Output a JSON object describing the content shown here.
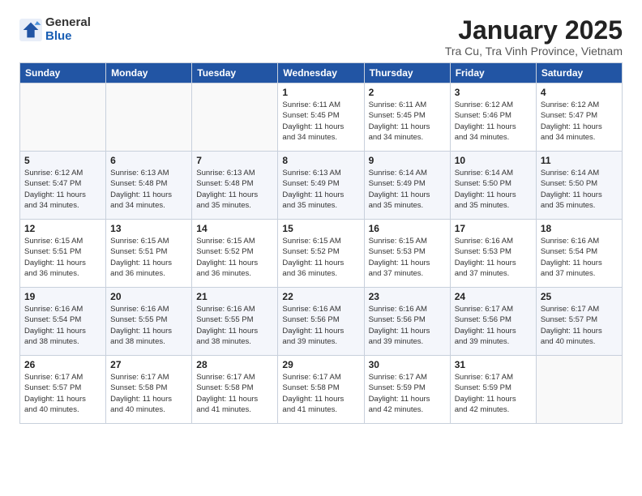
{
  "logo": {
    "general": "General",
    "blue": "Blue"
  },
  "title": "January 2025",
  "subtitle": "Tra Cu, Tra Vinh Province, Vietnam",
  "headers": [
    "Sunday",
    "Monday",
    "Tuesday",
    "Wednesday",
    "Thursday",
    "Friday",
    "Saturday"
  ],
  "weeks": [
    [
      {
        "day": "",
        "info": ""
      },
      {
        "day": "",
        "info": ""
      },
      {
        "day": "",
        "info": ""
      },
      {
        "day": "1",
        "info": "Sunrise: 6:11 AM\nSunset: 5:45 PM\nDaylight: 11 hours\nand 34 minutes."
      },
      {
        "day": "2",
        "info": "Sunrise: 6:11 AM\nSunset: 5:45 PM\nDaylight: 11 hours\nand 34 minutes."
      },
      {
        "day": "3",
        "info": "Sunrise: 6:12 AM\nSunset: 5:46 PM\nDaylight: 11 hours\nand 34 minutes."
      },
      {
        "day": "4",
        "info": "Sunrise: 6:12 AM\nSunset: 5:47 PM\nDaylight: 11 hours\nand 34 minutes."
      }
    ],
    [
      {
        "day": "5",
        "info": "Sunrise: 6:12 AM\nSunset: 5:47 PM\nDaylight: 11 hours\nand 34 minutes."
      },
      {
        "day": "6",
        "info": "Sunrise: 6:13 AM\nSunset: 5:48 PM\nDaylight: 11 hours\nand 34 minutes."
      },
      {
        "day": "7",
        "info": "Sunrise: 6:13 AM\nSunset: 5:48 PM\nDaylight: 11 hours\nand 35 minutes."
      },
      {
        "day": "8",
        "info": "Sunrise: 6:13 AM\nSunset: 5:49 PM\nDaylight: 11 hours\nand 35 minutes."
      },
      {
        "day": "9",
        "info": "Sunrise: 6:14 AM\nSunset: 5:49 PM\nDaylight: 11 hours\nand 35 minutes."
      },
      {
        "day": "10",
        "info": "Sunrise: 6:14 AM\nSunset: 5:50 PM\nDaylight: 11 hours\nand 35 minutes."
      },
      {
        "day": "11",
        "info": "Sunrise: 6:14 AM\nSunset: 5:50 PM\nDaylight: 11 hours\nand 35 minutes."
      }
    ],
    [
      {
        "day": "12",
        "info": "Sunrise: 6:15 AM\nSunset: 5:51 PM\nDaylight: 11 hours\nand 36 minutes."
      },
      {
        "day": "13",
        "info": "Sunrise: 6:15 AM\nSunset: 5:51 PM\nDaylight: 11 hours\nand 36 minutes."
      },
      {
        "day": "14",
        "info": "Sunrise: 6:15 AM\nSunset: 5:52 PM\nDaylight: 11 hours\nand 36 minutes."
      },
      {
        "day": "15",
        "info": "Sunrise: 6:15 AM\nSunset: 5:52 PM\nDaylight: 11 hours\nand 36 minutes."
      },
      {
        "day": "16",
        "info": "Sunrise: 6:15 AM\nSunset: 5:53 PM\nDaylight: 11 hours\nand 37 minutes."
      },
      {
        "day": "17",
        "info": "Sunrise: 6:16 AM\nSunset: 5:53 PM\nDaylight: 11 hours\nand 37 minutes."
      },
      {
        "day": "18",
        "info": "Sunrise: 6:16 AM\nSunset: 5:54 PM\nDaylight: 11 hours\nand 37 minutes."
      }
    ],
    [
      {
        "day": "19",
        "info": "Sunrise: 6:16 AM\nSunset: 5:54 PM\nDaylight: 11 hours\nand 38 minutes."
      },
      {
        "day": "20",
        "info": "Sunrise: 6:16 AM\nSunset: 5:55 PM\nDaylight: 11 hours\nand 38 minutes."
      },
      {
        "day": "21",
        "info": "Sunrise: 6:16 AM\nSunset: 5:55 PM\nDaylight: 11 hours\nand 38 minutes."
      },
      {
        "day": "22",
        "info": "Sunrise: 6:16 AM\nSunset: 5:56 PM\nDaylight: 11 hours\nand 39 minutes."
      },
      {
        "day": "23",
        "info": "Sunrise: 6:16 AM\nSunset: 5:56 PM\nDaylight: 11 hours\nand 39 minutes."
      },
      {
        "day": "24",
        "info": "Sunrise: 6:17 AM\nSunset: 5:56 PM\nDaylight: 11 hours\nand 39 minutes."
      },
      {
        "day": "25",
        "info": "Sunrise: 6:17 AM\nSunset: 5:57 PM\nDaylight: 11 hours\nand 40 minutes."
      }
    ],
    [
      {
        "day": "26",
        "info": "Sunrise: 6:17 AM\nSunset: 5:57 PM\nDaylight: 11 hours\nand 40 minutes."
      },
      {
        "day": "27",
        "info": "Sunrise: 6:17 AM\nSunset: 5:58 PM\nDaylight: 11 hours\nand 40 minutes."
      },
      {
        "day": "28",
        "info": "Sunrise: 6:17 AM\nSunset: 5:58 PM\nDaylight: 11 hours\nand 41 minutes."
      },
      {
        "day": "29",
        "info": "Sunrise: 6:17 AM\nSunset: 5:58 PM\nDaylight: 11 hours\nand 41 minutes."
      },
      {
        "day": "30",
        "info": "Sunrise: 6:17 AM\nSunset: 5:59 PM\nDaylight: 11 hours\nand 42 minutes."
      },
      {
        "day": "31",
        "info": "Sunrise: 6:17 AM\nSunset: 5:59 PM\nDaylight: 11 hours\nand 42 minutes."
      },
      {
        "day": "",
        "info": ""
      }
    ]
  ]
}
